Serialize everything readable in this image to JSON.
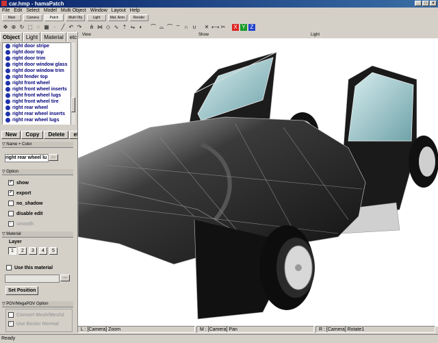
{
  "window": {
    "title": "car.hmp - hamaPatch"
  },
  "menu": [
    "File",
    "Edit",
    "Select",
    "Model",
    "Multi Object",
    "Window",
    "Layout",
    "Help"
  ],
  "mode_tabs": [
    "Main",
    "Camera",
    "Patch",
    "Multi Obj",
    "Light",
    "Mat. Anm.",
    "Render"
  ],
  "active_mode_tab": "Patch",
  "panel_tabs": [
    "Object",
    "Light",
    "Material",
    "etc."
  ],
  "objects": [
    "right door stripe",
    "right door top",
    "right door trim",
    "right door window glass",
    "right door window trim",
    "right fender top",
    "right front wheel",
    "right front wheel inserts",
    "right front wheel lugs",
    "right front wheel tire",
    "right rear wheel",
    "right rear wheel inserts",
    "right rear wheel lugs"
  ],
  "buttons": {
    "new": "New",
    "copy": "Copy",
    "delete": "Delete",
    "etc": "etc."
  },
  "sections": {
    "name_color": "Name + Color",
    "option": "Option",
    "material": "Material",
    "pov": "POV/MegaPOV Option"
  },
  "name_value": "right rear wheel lu",
  "browse_label": "...",
  "options": [
    {
      "label": "show",
      "checked": true,
      "enabled": true
    },
    {
      "label": "export",
      "checked": true,
      "enabled": true
    },
    {
      "label": "no_shadow",
      "checked": false,
      "enabled": true
    },
    {
      "label": "disable edit",
      "checked": false,
      "enabled": true
    },
    {
      "label": "smooth",
      "checked": true,
      "enabled": false
    }
  ],
  "layer": {
    "label": "Layer",
    "buttons": [
      "1",
      "2",
      "3",
      "4",
      "5"
    ],
    "selected": "1"
  },
  "use_material": "Use this material",
  "set_position": "Set Position",
  "pov_options": [
    {
      "label": "Convert Mesh/Mesh2",
      "checked": false
    },
    {
      "label": "Use Bezier Normal",
      "checked": true
    }
  ],
  "viewport": {
    "labels": [
      "View",
      "Show",
      "Light"
    ]
  },
  "mouse_hints": {
    "left": "L : [Camera] Zoom",
    "middle": "M : [Camera] Pan",
    "right": "R : [Camera] Rotate1"
  },
  "status": "Ready",
  "colors": {
    "titlebar": "#0a246a",
    "object_text": "#00007a",
    "car_body": "#1a1a1a",
    "glass": "#7ab0b6"
  }
}
